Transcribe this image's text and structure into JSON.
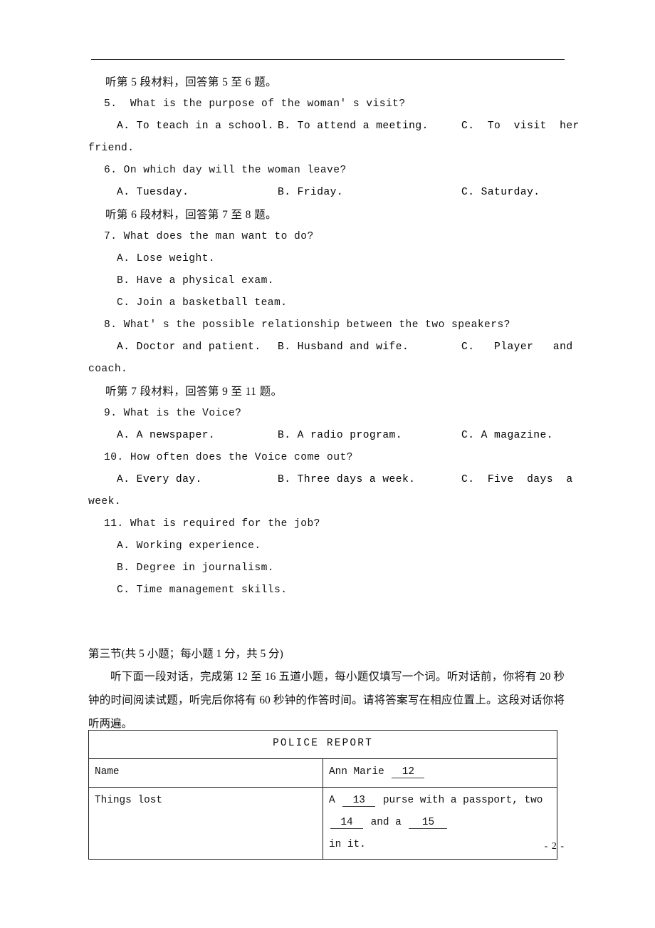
{
  "document": {
    "page_number": "- 2 -",
    "header_rule": true
  },
  "listening": {
    "prompt_5_6": "听第 5 段材料，回答第 5 至 6 题。",
    "prompt_7_8": "听第 6 段材料，回答第 7 至 8 题。",
    "prompt_9_11": "听第 7 段材料，回答第 9 至 11 题。",
    "questions": [
      {
        "number": "5.",
        "stem": "5.  What is the purpose of the woman' s visit?",
        "options": [
          "A. To teach in a school.",
          "B. To attend a meeting.",
          "C.  To  visit  her"
        ],
        "overflow": "friend."
      },
      {
        "number": "6.",
        "stem": "6. On which day will the woman leave?",
        "options": [
          "A. Tuesday.",
          "B. Friday.",
          "C. Saturday."
        ],
        "overflow": ""
      },
      {
        "number": "7.",
        "stem": "7. What does the man want to do?",
        "stacked_options": [
          "A. Lose weight.",
          "B. Have a physical exam.",
          "C. Join a basketball team."
        ]
      },
      {
        "number": "8.",
        "stem": "8. What' s the possible relationship between the two speakers?",
        "options": [
          "A. Doctor and patient.",
          "B. Husband and wife.",
          "C.   Player   and"
        ],
        "overflow": "coach."
      },
      {
        "number": "9.",
        "stem": "9. What is the Voice?",
        "options": [
          "A. A newspaper.",
          "B. A radio program.",
          "C. A magazine."
        ],
        "overflow": ""
      },
      {
        "number": "10.",
        "stem": "10. How often does the Voice come out?",
        "options": [
          "A. Every day.",
          "B. Three days a week.",
          "C.  Five  days  a"
        ],
        "overflow": "week."
      },
      {
        "number": "11.",
        "stem": "11. What is required for the job?",
        "stacked_options": [
          "A. Working experience.",
          "B. Degree in journalism.",
          "C. Time management skills."
        ]
      }
    ]
  },
  "section_three": {
    "title": "第三节(共 5 小题；每小题 1 分，共 5 分)",
    "instructions": "听下面一段对话，完成第 12 至 16 五道小题，每小题仅填写一个词。听对话前，你将有 20 秒钟的时间阅读试题，听完后你将有 60 秒钟的作答时间。请将答案写在相应位置上。这段对话你将听两遍。"
  },
  "police_report": {
    "title": "POLICE REPORT",
    "rows": [
      {
        "label": "Name",
        "value_prefix": "Ann Marie ",
        "blanks": [
          "12"
        ],
        "value_suffix": ""
      },
      {
        "label": "Things lost",
        "segments": [
          "A ",
          "13",
          " purse with a passport, two ",
          "14",
          " and a ",
          "15"
        ],
        "second_line": "in it."
      }
    ]
  }
}
